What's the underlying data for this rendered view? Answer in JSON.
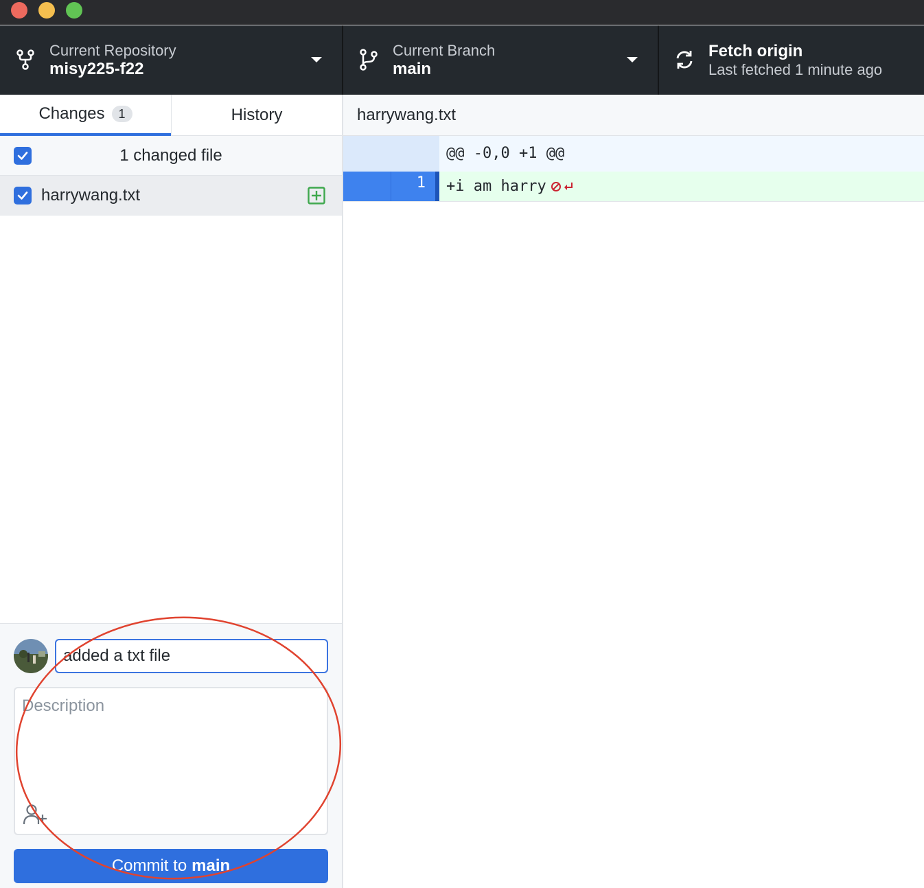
{
  "window": {
    "traffic_lights": {
      "close": "#ed6a5e",
      "minimize": "#f5bf4f",
      "zoom": "#61c454"
    }
  },
  "toolbar": {
    "repository": {
      "label": "Current Repository",
      "value": "misy225-f22",
      "icon": "repo-fork-icon"
    },
    "branch": {
      "label": "Current Branch",
      "value": "main",
      "icon": "git-branch-icon"
    },
    "fetch": {
      "label": "Fetch origin",
      "status": "Last fetched 1 minute ago",
      "icon": "sync-icon"
    }
  },
  "sidebar": {
    "tabs": [
      {
        "label": "Changes",
        "badge": "1",
        "selected": true
      },
      {
        "label": "History",
        "selected": false
      }
    ],
    "changed_summary": "1 changed file",
    "files": [
      {
        "name": "harrywang.txt",
        "checked": true,
        "status": "added"
      }
    ]
  },
  "commit": {
    "summary_value": "added a txt file",
    "description_placeholder": "Description",
    "button_prefix": "Commit to",
    "button_branch": "main"
  },
  "diff": {
    "filename": "harrywang.txt",
    "hunk_header": "@@ -0,0 +1 @@",
    "lines": [
      {
        "old_number": "",
        "new_number": "1",
        "text": "+i am harry",
        "type": "added",
        "no_newline_at_end": true
      }
    ]
  },
  "colors": {
    "accent": "#2f6fde",
    "toolbar_bg": "#24292e",
    "added_bg": "#e6ffed",
    "annotation": "#e0432f"
  }
}
